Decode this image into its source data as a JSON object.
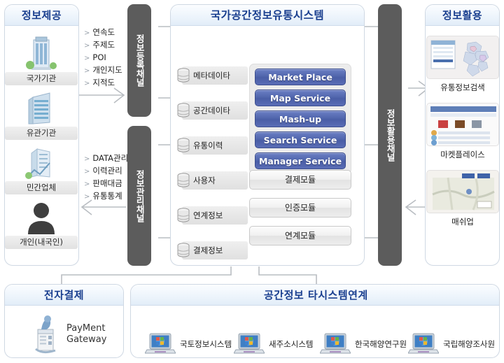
{
  "providers": {
    "title": "정보제공",
    "entities": [
      {
        "label": "국가기관",
        "icon": "office-building-icon"
      },
      {
        "label": "유관기관",
        "icon": "server-building-icon"
      },
      {
        "label": "민간업체",
        "icon": "company-building-icon"
      },
      {
        "label": "개인(내국인)",
        "icon": "person-icon"
      }
    ]
  },
  "register_list": {
    "items": [
      "연속도",
      "주제도",
      "POI",
      "개인지도",
      "지적도"
    ],
    "marker": "chevron-right-marker"
  },
  "manage_list": {
    "items": [
      "DATA관리",
      "이력관리",
      "판매대금",
      "유통통계"
    ],
    "marker": "chevron-right-marker"
  },
  "channels": {
    "register": "정보등록채널",
    "manage": "정보관리채널",
    "usage": "정보활용채널"
  },
  "core": {
    "title": "국가공간정보유통시스템",
    "databases": [
      "메타데이타",
      "공간데이타",
      "유통이력",
      "사용자",
      "연계정보",
      "결제정보"
    ],
    "services": [
      "Market Place",
      "Map Service",
      "Mash-up",
      "Search Service",
      "Manager Service"
    ],
    "modules": [
      "결제모듈",
      "인증모듈",
      "연계모듈"
    ]
  },
  "usage": {
    "title": "정보활용",
    "items": [
      {
        "label": "유통정보검색",
        "thumb": "korea-map-search-thumb"
      },
      {
        "label": "마켓플레이스",
        "thumb": "marketplace-listing-thumb"
      },
      {
        "label": "매쉬업",
        "thumb": "mashup-map-thumb"
      }
    ]
  },
  "payment": {
    "title": "전자결제",
    "icon": "payment-gateway-icon",
    "label_line1": "PayMent",
    "label_line2": "Gateway"
  },
  "interop": {
    "title": "공간정보 타시스템연계",
    "systems": [
      {
        "label": "국토정보시스템",
        "icon": "laptop-icon"
      },
      {
        "label": "새주소시스템",
        "icon": "laptop-icon"
      },
      {
        "label": "한국해양연구원",
        "icon": "laptop-icon"
      },
      {
        "label": "국립해양조사원",
        "icon": "laptop-icon"
      }
    ]
  },
  "colors": {
    "header_text": "#1a3f8f",
    "channel_bar": "#5c5c5c",
    "service_button": "#4a5ea6",
    "wire": "#b9bdc2"
  }
}
